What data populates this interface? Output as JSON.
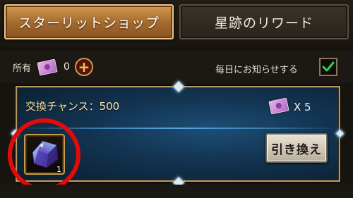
{
  "tabs": [
    {
      "label": "スターリットショップ",
      "active": true
    },
    {
      "label": "星跡のリワード",
      "active": false
    }
  ],
  "ownership": {
    "label": "所有",
    "count": "0",
    "plus_symbol": "+"
  },
  "daily_notify": {
    "label": "毎日にお知らせする",
    "checked": true
  },
  "exchange": {
    "chances_label": "交換チャンス：500",
    "cost_label": "X 5",
    "item_quantity": "1",
    "refresh_button_label": "引き換え"
  },
  "colors": {
    "active_tab": "#b97a38",
    "panel_blue": "#123350",
    "frame_gold": "#b89a62",
    "highlight_red": "#e50a0a",
    "check_green": "#2fd24c"
  },
  "icons": {
    "currency": "starlit-ticket-icon",
    "item": "crystal-gem-icon",
    "check": "checkmark-icon",
    "plus": "plus-icon"
  }
}
